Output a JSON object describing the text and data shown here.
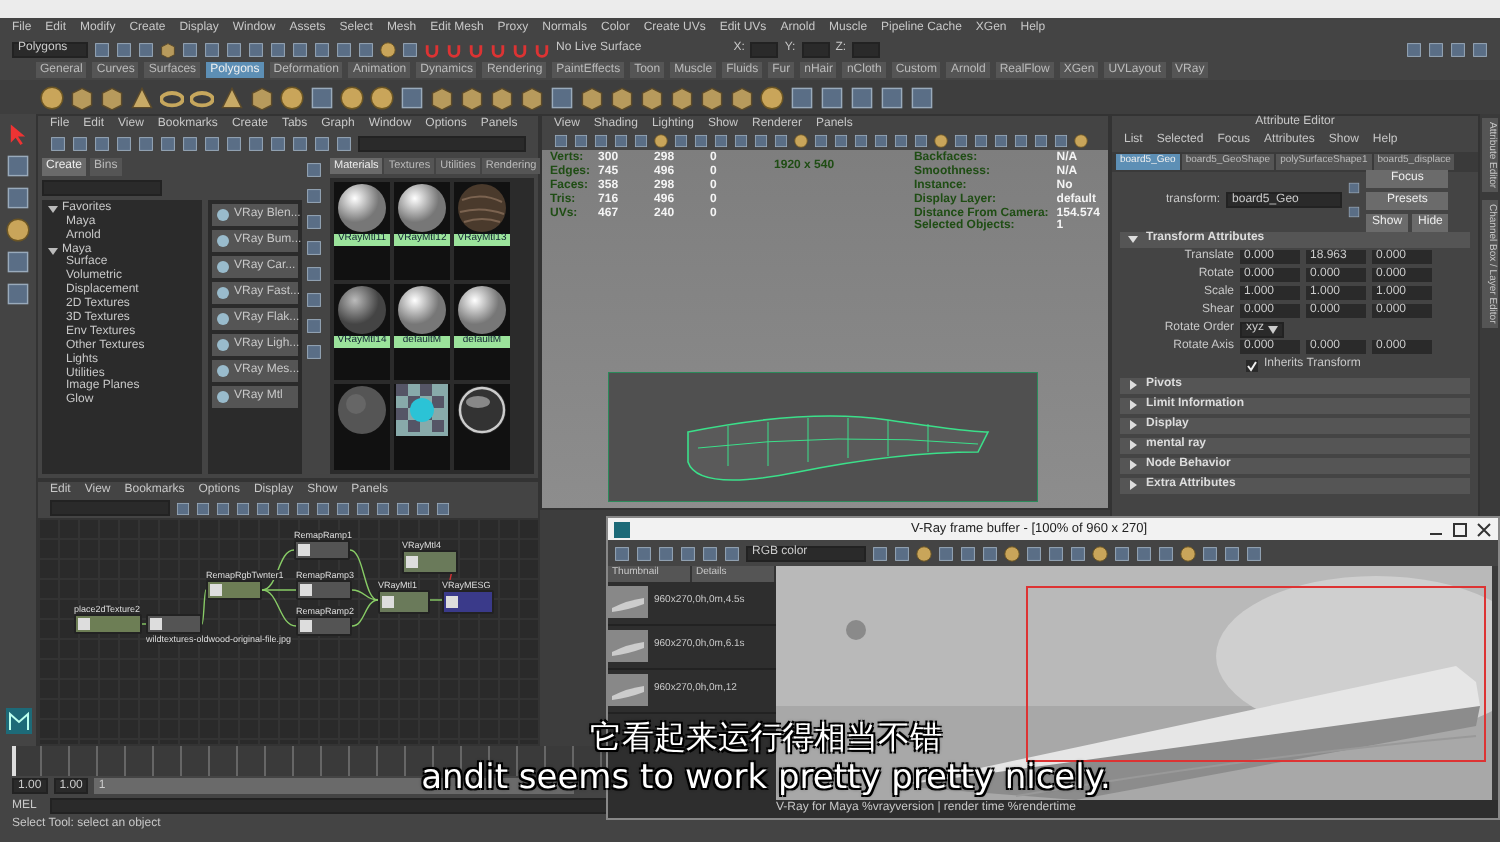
{
  "menu_bar": [
    "File",
    "Edit",
    "Modify",
    "Create",
    "Display",
    "Window",
    "Assets",
    "Select",
    "Mesh",
    "Edit Mesh",
    "Proxy",
    "Normals",
    "Color",
    "Create UVs",
    "Edit UVs",
    "Arnold",
    "Muscle",
    "Pipeline Cache",
    "XGen",
    "Help"
  ],
  "status_line": {
    "mode": "Polygons",
    "live_surface": "No Live Surface",
    "coord_labels": [
      "X:",
      "Y:",
      "Z:"
    ]
  },
  "shelf_tabs": [
    {
      "label": "General",
      "selected": false
    },
    {
      "label": "Curves",
      "selected": false
    },
    {
      "label": "Surfaces",
      "selected": false
    },
    {
      "label": "Polygons",
      "selected": true
    },
    {
      "label": "Deformation",
      "selected": false
    },
    {
      "label": "Animation",
      "selected": false
    },
    {
      "label": "Dynamics",
      "selected": false
    },
    {
      "label": "Rendering",
      "selected": false
    },
    {
      "label": "PaintEffects",
      "selected": false
    },
    {
      "label": "Toon",
      "selected": false
    },
    {
      "label": "Muscle",
      "selected": false
    },
    {
      "label": "Fluids",
      "selected": false
    },
    {
      "label": "Fur",
      "selected": false
    },
    {
      "label": "nHair",
      "selected": false
    },
    {
      "label": "nCloth",
      "selected": false
    },
    {
      "label": "Custom",
      "selected": false
    },
    {
      "label": "Arnold",
      "selected": false
    },
    {
      "label": "RealFlow",
      "selected": false
    },
    {
      "label": "XGen",
      "selected": false
    },
    {
      "label": "UVLayout",
      "selected": false
    },
    {
      "label": "VRay",
      "selected": false
    }
  ],
  "hypershade": {
    "menu": [
      "File",
      "Edit",
      "View",
      "Bookmarks",
      "Create",
      "Tabs",
      "Graph",
      "Window",
      "Options",
      "Panels"
    ],
    "create_tabs": [
      {
        "label": "Create",
        "selected": true
      },
      {
        "label": "Bins",
        "selected": false
      }
    ],
    "tree": [
      {
        "label": "Favorites",
        "expanded": true,
        "children": [
          {
            "label": "Maya"
          },
          {
            "label": "Arnold"
          }
        ]
      },
      {
        "label": "Maya",
        "expanded": true,
        "children": [
          {
            "label": "Surface"
          },
          {
            "label": "Volumetric"
          },
          {
            "label": "Displacement"
          },
          {
            "label": "2D Textures"
          },
          {
            "label": "3D Textures"
          },
          {
            "label": "Env Textures"
          },
          {
            "label": "Other Textures"
          },
          {
            "label": "Lights"
          },
          {
            "label": "Utilities"
          },
          {
            "label": "Image Planes"
          },
          {
            "label": "Glow"
          }
        ]
      }
    ],
    "node_types": [
      "VRay Blen...",
      "VRay Bum...",
      "VRay Car...",
      "VRay Fast...",
      "VRay Flak...",
      "VRay Ligh...",
      "VRay Mes...",
      "VRay Mtl"
    ],
    "swatch_tabs": [
      {
        "label": "Materials",
        "selected": true
      },
      {
        "label": "Textures",
        "selected": false
      },
      {
        "label": "Utilities",
        "selected": false
      },
      {
        "label": "Rendering",
        "selected": false
      }
    ],
    "swatches": [
      {
        "label": "VRayMtl11",
        "kind": "white"
      },
      {
        "label": "VRayMtl12",
        "kind": "white"
      },
      {
        "label": "VRayMtl13",
        "kind": "wood"
      },
      {
        "label": "VRayMtl14",
        "kind": "grey"
      },
      {
        "label": "defaultM",
        "kind": "white"
      },
      {
        "label": "defaultM",
        "kind": "white"
      },
      {
        "kind": "dark"
      },
      {
        "kind": "checker"
      },
      {
        "kind": "chrome"
      }
    ]
  },
  "node_editor": {
    "menu": [
      "Edit",
      "View",
      "Bookmarks",
      "Options",
      "Display",
      "Show",
      "Panels"
    ],
    "nodes": [
      {
        "label": "RemapRamp1",
        "kind": "texture"
      },
      {
        "label": "VRayMtl4",
        "kind": "material"
      },
      {
        "label": "RemapRgbTwnter1",
        "kind": "utility"
      },
      {
        "label": "RemapRamp3",
        "kind": "texture"
      },
      {
        "label": "VRayMtl1",
        "kind": "material"
      },
      {
        "label": "VRayMESG",
        "kind": "shading_group"
      },
      {
        "label": "place2dTexture2",
        "kind": "utility"
      },
      {
        "label": "wildtextures-oldwood-original-file.jpg",
        "kind": "texture"
      },
      {
        "label": "RemapRamp2",
        "kind": "texture"
      }
    ]
  },
  "viewport": {
    "menu": [
      "View",
      "Shading",
      "Lighting",
      "Show",
      "Renderer",
      "Panels"
    ],
    "hud_stats": [
      {
        "label": "Verts:",
        "values": [
          "300",
          "298",
          "0"
        ]
      },
      {
        "label": "Edges:",
        "values": [
          "745",
          "496",
          "0"
        ]
      },
      {
        "label": "Faces:",
        "values": [
          "358",
          "298",
          "0"
        ]
      },
      {
        "label": "Tris:",
        "values": [
          "716",
          "496",
          "0"
        ]
      },
      {
        "label": "UVs:",
        "values": [
          "467",
          "240",
          "0"
        ]
      }
    ],
    "resolution": "1920 x 540",
    "hud_info": [
      {
        "label": "Backfaces:",
        "value": "N/A"
      },
      {
        "label": "Smoothness:",
        "value": "N/A"
      },
      {
        "label": "Instance:",
        "value": "No"
      },
      {
        "label": "Display Layer:",
        "value": "default"
      },
      {
        "label": "Distance From Camera:",
        "value": "154.574"
      },
      {
        "label": "Selected Objects:",
        "value": "1"
      }
    ]
  },
  "attribute_editor": {
    "title": "Attribute Editor",
    "menu": [
      "List",
      "Selected",
      "Focus",
      "Attributes",
      "Show",
      "Help"
    ],
    "tabs": [
      {
        "label": "board5_Geo",
        "selected": true
      },
      {
        "label": "board5_GeoShape",
        "selected": false
      },
      {
        "label": "polySurfaceShape1",
        "selected": false
      },
      {
        "label": "board5_displace",
        "selected": false
      }
    ],
    "transform_label": "transform:",
    "transform_value": "board5_Geo",
    "buttons": [
      "Focus",
      "Presets",
      "Show",
      "Hide"
    ],
    "sections": [
      {
        "title": "Transform Attributes",
        "expanded": true,
        "rows": [
          {
            "kind": "vector",
            "label": "Translate",
            "values": [
              "0.000",
              "18.963",
              "0.000"
            ]
          },
          {
            "kind": "vector",
            "label": "Rotate",
            "values": [
              "0.000",
              "0.000",
              "0.000"
            ]
          },
          {
            "kind": "vector",
            "label": "Scale",
            "values": [
              "1.000",
              "1.000",
              "1.000"
            ]
          },
          {
            "kind": "vector",
            "label": "Shear",
            "values": [
              "0.000",
              "0.000",
              "0.000"
            ]
          },
          {
            "kind": "dropdown",
            "label": "Rotate Order",
            "value": "xyz"
          },
          {
            "kind": "vector",
            "label": "Rotate Axis",
            "values": [
              "0.000",
              "0.000",
              "0.000"
            ]
          },
          {
            "kind": "checkbox",
            "label": "Inherits Transform",
            "checked": true
          }
        ]
      },
      {
        "title": "Pivots",
        "expanded": false
      },
      {
        "title": "Limit Information",
        "expanded": false
      },
      {
        "title": "Display",
        "expanded": false
      },
      {
        "title": "mental ray",
        "expanded": false
      },
      {
        "title": "Node Behavior",
        "expanded": false
      },
      {
        "title": "Extra Attributes",
        "expanded": false
      }
    ]
  },
  "side_tabs": [
    "Attribute Editor",
    "Channel Box / Layer Editor"
  ],
  "time_slider": {
    "level": 0
  },
  "range_slider": {
    "start": "1.00",
    "end": "1.00",
    "current": "1",
    "level": 1
  },
  "command_line": {
    "label": "MEL"
  },
  "help_line": "Select Tool: select an object",
  "frame_buffer": {
    "title": "V-Ray frame buffer - [100% of 960 x 270]",
    "channel": "RGB color",
    "history_columns": [
      "Thumbnail",
      "Details"
    ],
    "history": [
      {
        "details": "960x270,0h,0m,4.5s",
        "selected": false
      },
      {
        "details": "960x270,0h,0m,6.1s",
        "selected": false
      },
      {
        "details": "960x270,0h,0m,12",
        "selected": false
      }
    ],
    "status": "V-Ray for Maya %vrayversion | render time %rendertime"
  },
  "subtitles": [
    "它看起来运行得相当不错",
    "andit seems to work pretty pretty nicely."
  ]
}
